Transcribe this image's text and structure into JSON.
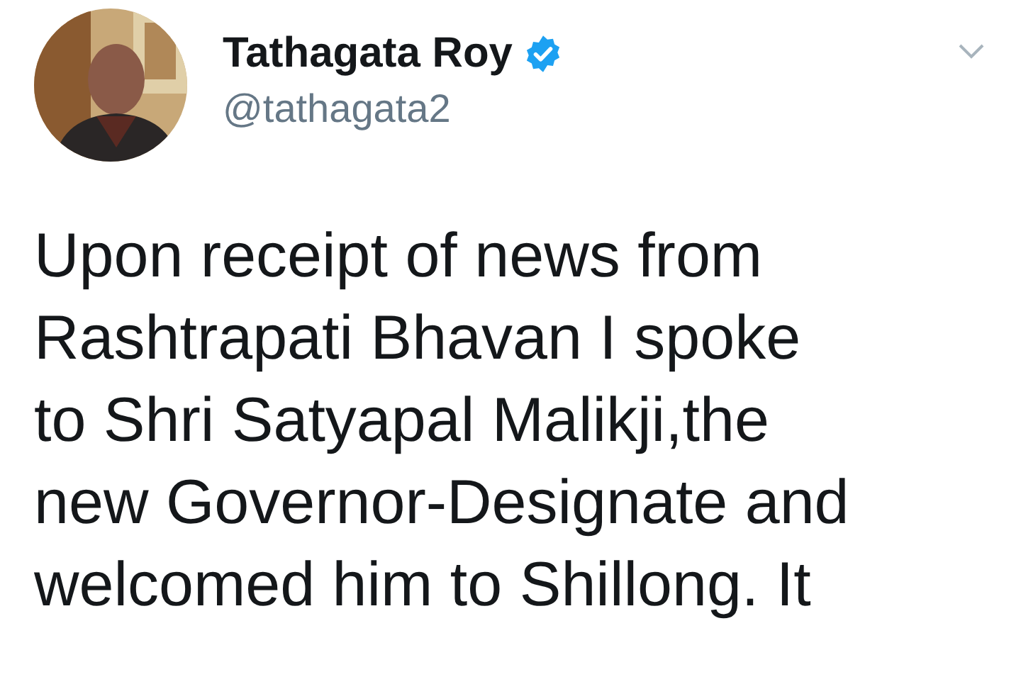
{
  "author": {
    "name": "Tathagata Roy",
    "verified": true,
    "handle": "@tathagata2"
  },
  "text_lines": [
    "Upon receipt of news from",
    "Rashtrapati Bhavan I spoke",
    "to Shri Satyapal Malikji,the",
    "new Governor-Designate and",
    "welcomed him to Shillong. It"
  ]
}
